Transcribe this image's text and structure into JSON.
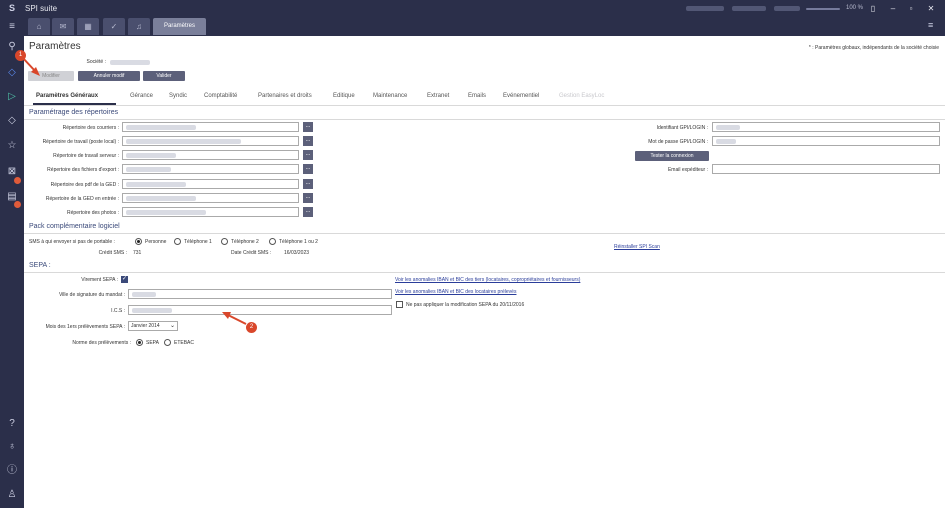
{
  "window": {
    "title": "SPI suite",
    "logo": "S",
    "zoom": "100 %"
  },
  "tabs_top": {
    "active_label": "Paramètres"
  },
  "header": {
    "title": "Paramètres",
    "note": "* : Paramètres globaux, indépendants de la société choisie",
    "societe_label": "Société :"
  },
  "actions": {
    "modifier": "Modifier",
    "annuler": "Annuler modif",
    "valider": "Valider"
  },
  "tabs": [
    "Paramètres Généraux",
    "Gérance",
    "Syndic",
    "Comptabilité",
    "Partenaires et droits",
    "Editique",
    "Maintenance",
    "Extranet",
    "Emails",
    "Evénementiel",
    "Gestion EasyLoc"
  ],
  "repertoires": {
    "title": "Paramétrage des répertoires",
    "fields": [
      "Répertoire des courriers :",
      "Répertoire de travail (poste local) :",
      "Répertoire de travail serveur :",
      "Répertoire des fichiers d'export :",
      "Répertoire des pdf de la GED :",
      "Répertoire de la GED en entrée :",
      "Répertoire des photos :"
    ],
    "dots": "..."
  },
  "gpi": {
    "identifiant": "Identifiant GPI/LOGIN :",
    "motdepasse": "Mot de passe GPI/LOGIN :",
    "tester": "Tester la connexion",
    "email": "Email expéditeur :"
  },
  "pack": {
    "title": "Pack complémentaire logiciel",
    "sms_label": "SMS à qui envoyer si pas de portable :",
    "options": [
      "Personne",
      "Téléphone 1",
      "Téléphone 2",
      "Téléphone 1 ou 2"
    ],
    "credit_label": "Crédit SMS :",
    "credit_value": "731",
    "date_label": "Date Crédit SMS :",
    "date_value": "16/03/2023",
    "reinstall": "Réinstaller SPI Scan"
  },
  "sepa": {
    "title": "SEPA :",
    "virement": "Virement SEPA :",
    "ville": "Ville de signature du mandat :",
    "ics": "I.C.S :",
    "mois_label": "Mois des 1ers prélèvements SEPA :",
    "mois_value": "Janvier 2014",
    "norme_label": "Norme des prélèvements :",
    "norme_options": [
      "SEPA",
      "ETEBAC"
    ],
    "link1": "Voir les anomalies IBAN et BIC des tiers (locataires, copropriétaires et fournisseurs)",
    "link2": "Voir les anomalies IBAN et BIC des locataires prélevés",
    "no_apply": "Ne pas appliquer la modification SEPA du 20/11/2016"
  },
  "markers": [
    "1",
    "2"
  ]
}
